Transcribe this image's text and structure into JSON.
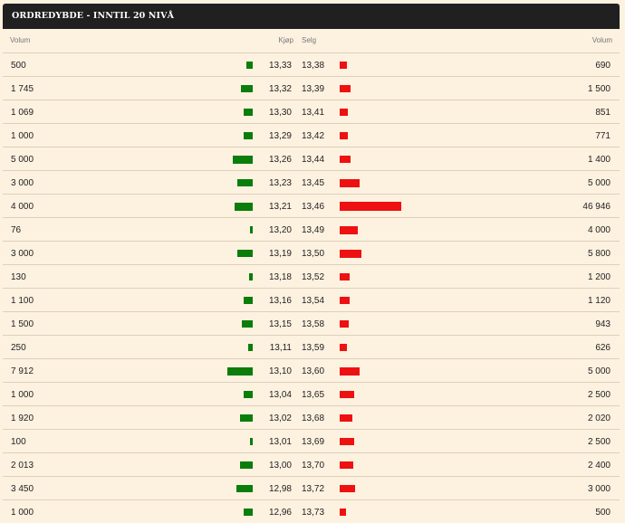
{
  "header": {
    "title": "ORDREDYBDE - INNTIL 20 NIVÅ"
  },
  "columns": {
    "volume_bid": "Volum",
    "bid": "Kjøp",
    "ask": "Selg",
    "volume_ask": "Volum"
  },
  "colors": {
    "bid_bar": "#0a7d0a",
    "ask_bar": "#ee1111",
    "background": "#fdf1e0",
    "header_bg": "#202020"
  },
  "rows": [
    {
      "vol_bid": "500",
      "bid": "13,33",
      "ask": "13,38",
      "vol_ask": "690"
    },
    {
      "vol_bid": "1 745",
      "bid": "13,32",
      "ask": "13,39",
      "vol_ask": "1 500"
    },
    {
      "vol_bid": "1 069",
      "bid": "13,30",
      "ask": "13,41",
      "vol_ask": "851"
    },
    {
      "vol_bid": "1 000",
      "bid": "13,29",
      "ask": "13,42",
      "vol_ask": "771"
    },
    {
      "vol_bid": "5 000",
      "bid": "13,26",
      "ask": "13,44",
      "vol_ask": "1 400"
    },
    {
      "vol_bid": "3 000",
      "bid": "13,23",
      "ask": "13,45",
      "vol_ask": "5 000"
    },
    {
      "vol_bid": "4 000",
      "bid": "13,21",
      "ask": "13,46",
      "vol_ask": "46 946"
    },
    {
      "vol_bid": "76",
      "bid": "13,20",
      "ask": "13,49",
      "vol_ask": "4 000"
    },
    {
      "vol_bid": "3 000",
      "bid": "13,19",
      "ask": "13,50",
      "vol_ask": "5 800"
    },
    {
      "vol_bid": "130",
      "bid": "13,18",
      "ask": "13,52",
      "vol_ask": "1 200"
    },
    {
      "vol_bid": "1 100",
      "bid": "13,16",
      "ask": "13,54",
      "vol_ask": "1 120"
    },
    {
      "vol_bid": "1 500",
      "bid": "13,15",
      "ask": "13,58",
      "vol_ask": "943"
    },
    {
      "vol_bid": "250",
      "bid": "13,11",
      "ask": "13,59",
      "vol_ask": "626"
    },
    {
      "vol_bid": "7 912",
      "bid": "13,10",
      "ask": "13,60",
      "vol_ask": "5 000"
    },
    {
      "vol_bid": "1 000",
      "bid": "13,04",
      "ask": "13,65",
      "vol_ask": "2 500"
    },
    {
      "vol_bid": "1 920",
      "bid": "13,02",
      "ask": "13,68",
      "vol_ask": "2 020"
    },
    {
      "vol_bid": "100",
      "bid": "13,01",
      "ask": "13,69",
      "vol_ask": "2 500"
    },
    {
      "vol_bid": "2 013",
      "bid": "13,00",
      "ask": "13,70",
      "vol_ask": "2 400"
    },
    {
      "vol_bid": "3 450",
      "bid": "12,98",
      "ask": "13,72",
      "vol_ask": "3 000"
    },
    {
      "vol_bid": "1 000",
      "bid": "12,96",
      "ask": "13,73",
      "vol_ask": "500"
    }
  ]
}
